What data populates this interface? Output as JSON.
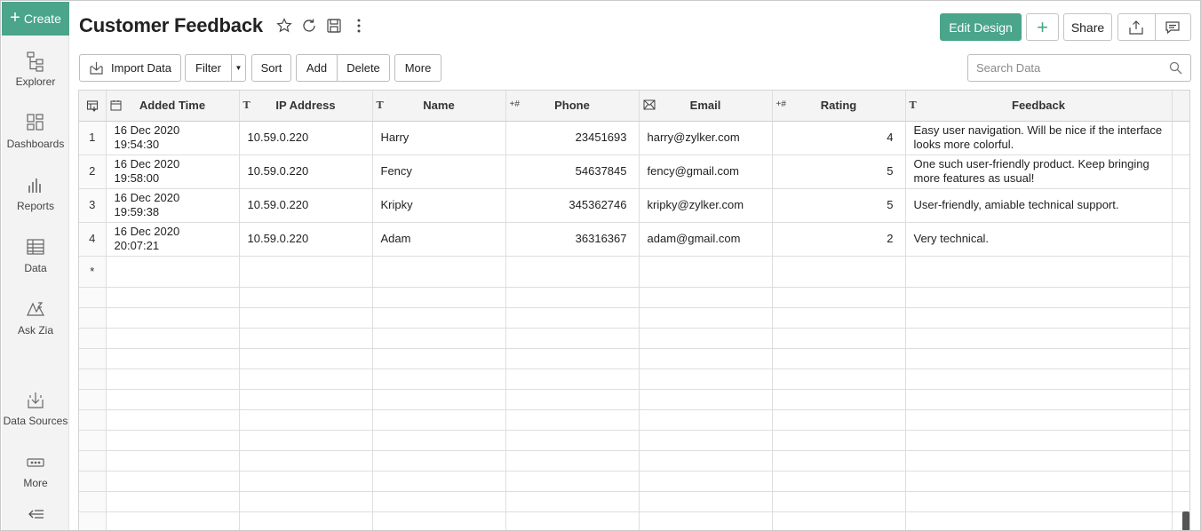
{
  "sidebar": {
    "create_label": "Create",
    "items": [
      {
        "label": "Explorer",
        "icon": "explorer-icon"
      },
      {
        "label": "Dashboards",
        "icon": "dashboards-icon"
      },
      {
        "label": "Reports",
        "icon": "reports-icon"
      },
      {
        "label": "Data",
        "icon": "data-icon"
      },
      {
        "label": "Ask Zia",
        "icon": "ask-zia-icon"
      },
      {
        "label": "Data Sources",
        "icon": "data-sources-icon"
      },
      {
        "label": "More",
        "icon": "more-icon"
      }
    ]
  },
  "header": {
    "title": "Customer Feedback",
    "edit_design_label": "Edit Design",
    "share_label": "Share"
  },
  "toolbar": {
    "import_label": "Import Data",
    "filter_label": "Filter",
    "sort_label": "Sort",
    "add_label": "Add",
    "delete_label": "Delete",
    "more_label": "More",
    "search_placeholder": "Search Data"
  },
  "table": {
    "columns": [
      {
        "label": "Added Time",
        "type_icon": "calendar-icon"
      },
      {
        "label": "IP Address",
        "type_icon": "T"
      },
      {
        "label": "Name",
        "type_icon": "T"
      },
      {
        "label": "Phone",
        "type_icon": "+#"
      },
      {
        "label": "Email",
        "type_icon": "envelope-icon"
      },
      {
        "label": "Rating",
        "type_icon": "+#"
      },
      {
        "label": "Feedback",
        "type_icon": "T"
      }
    ],
    "rows": [
      {
        "n": "1",
        "time_date": "16 Dec 2020",
        "time_clock": "19:54:30",
        "ip": "10.59.0.220",
        "name": "Harry",
        "phone": "23451693",
        "email": "harry@zylker.com",
        "rating": "4",
        "feedback": "Easy user navigation. Will be nice if the interface looks more colorful."
      },
      {
        "n": "2",
        "time_date": "16 Dec 2020",
        "time_clock": "19:58:00",
        "ip": "10.59.0.220",
        "name": "Fency",
        "phone": "54637845",
        "email": "fency@gmail.com",
        "rating": "5",
        "feedback": "One such user-friendly product. Keep bringing more features as usual!"
      },
      {
        "n": "3",
        "time_date": "16 Dec 2020",
        "time_clock": "19:59:38",
        "ip": "10.59.0.220",
        "name": "Kripky",
        "phone": "345362746",
        "email": "kripky@zylker.com",
        "rating": "5",
        "feedback": "User-friendly, amiable technical support."
      },
      {
        "n": "4",
        "time_date": "16 Dec 2020",
        "time_clock": "20:07:21",
        "ip": "10.59.0.220",
        "name": "Adam",
        "phone": "36316367",
        "email": "adam@gmail.com",
        "rating": "2",
        "feedback": "Very technical."
      }
    ],
    "new_row_marker": "*"
  },
  "colors": {
    "accent": "#4aa58a"
  }
}
